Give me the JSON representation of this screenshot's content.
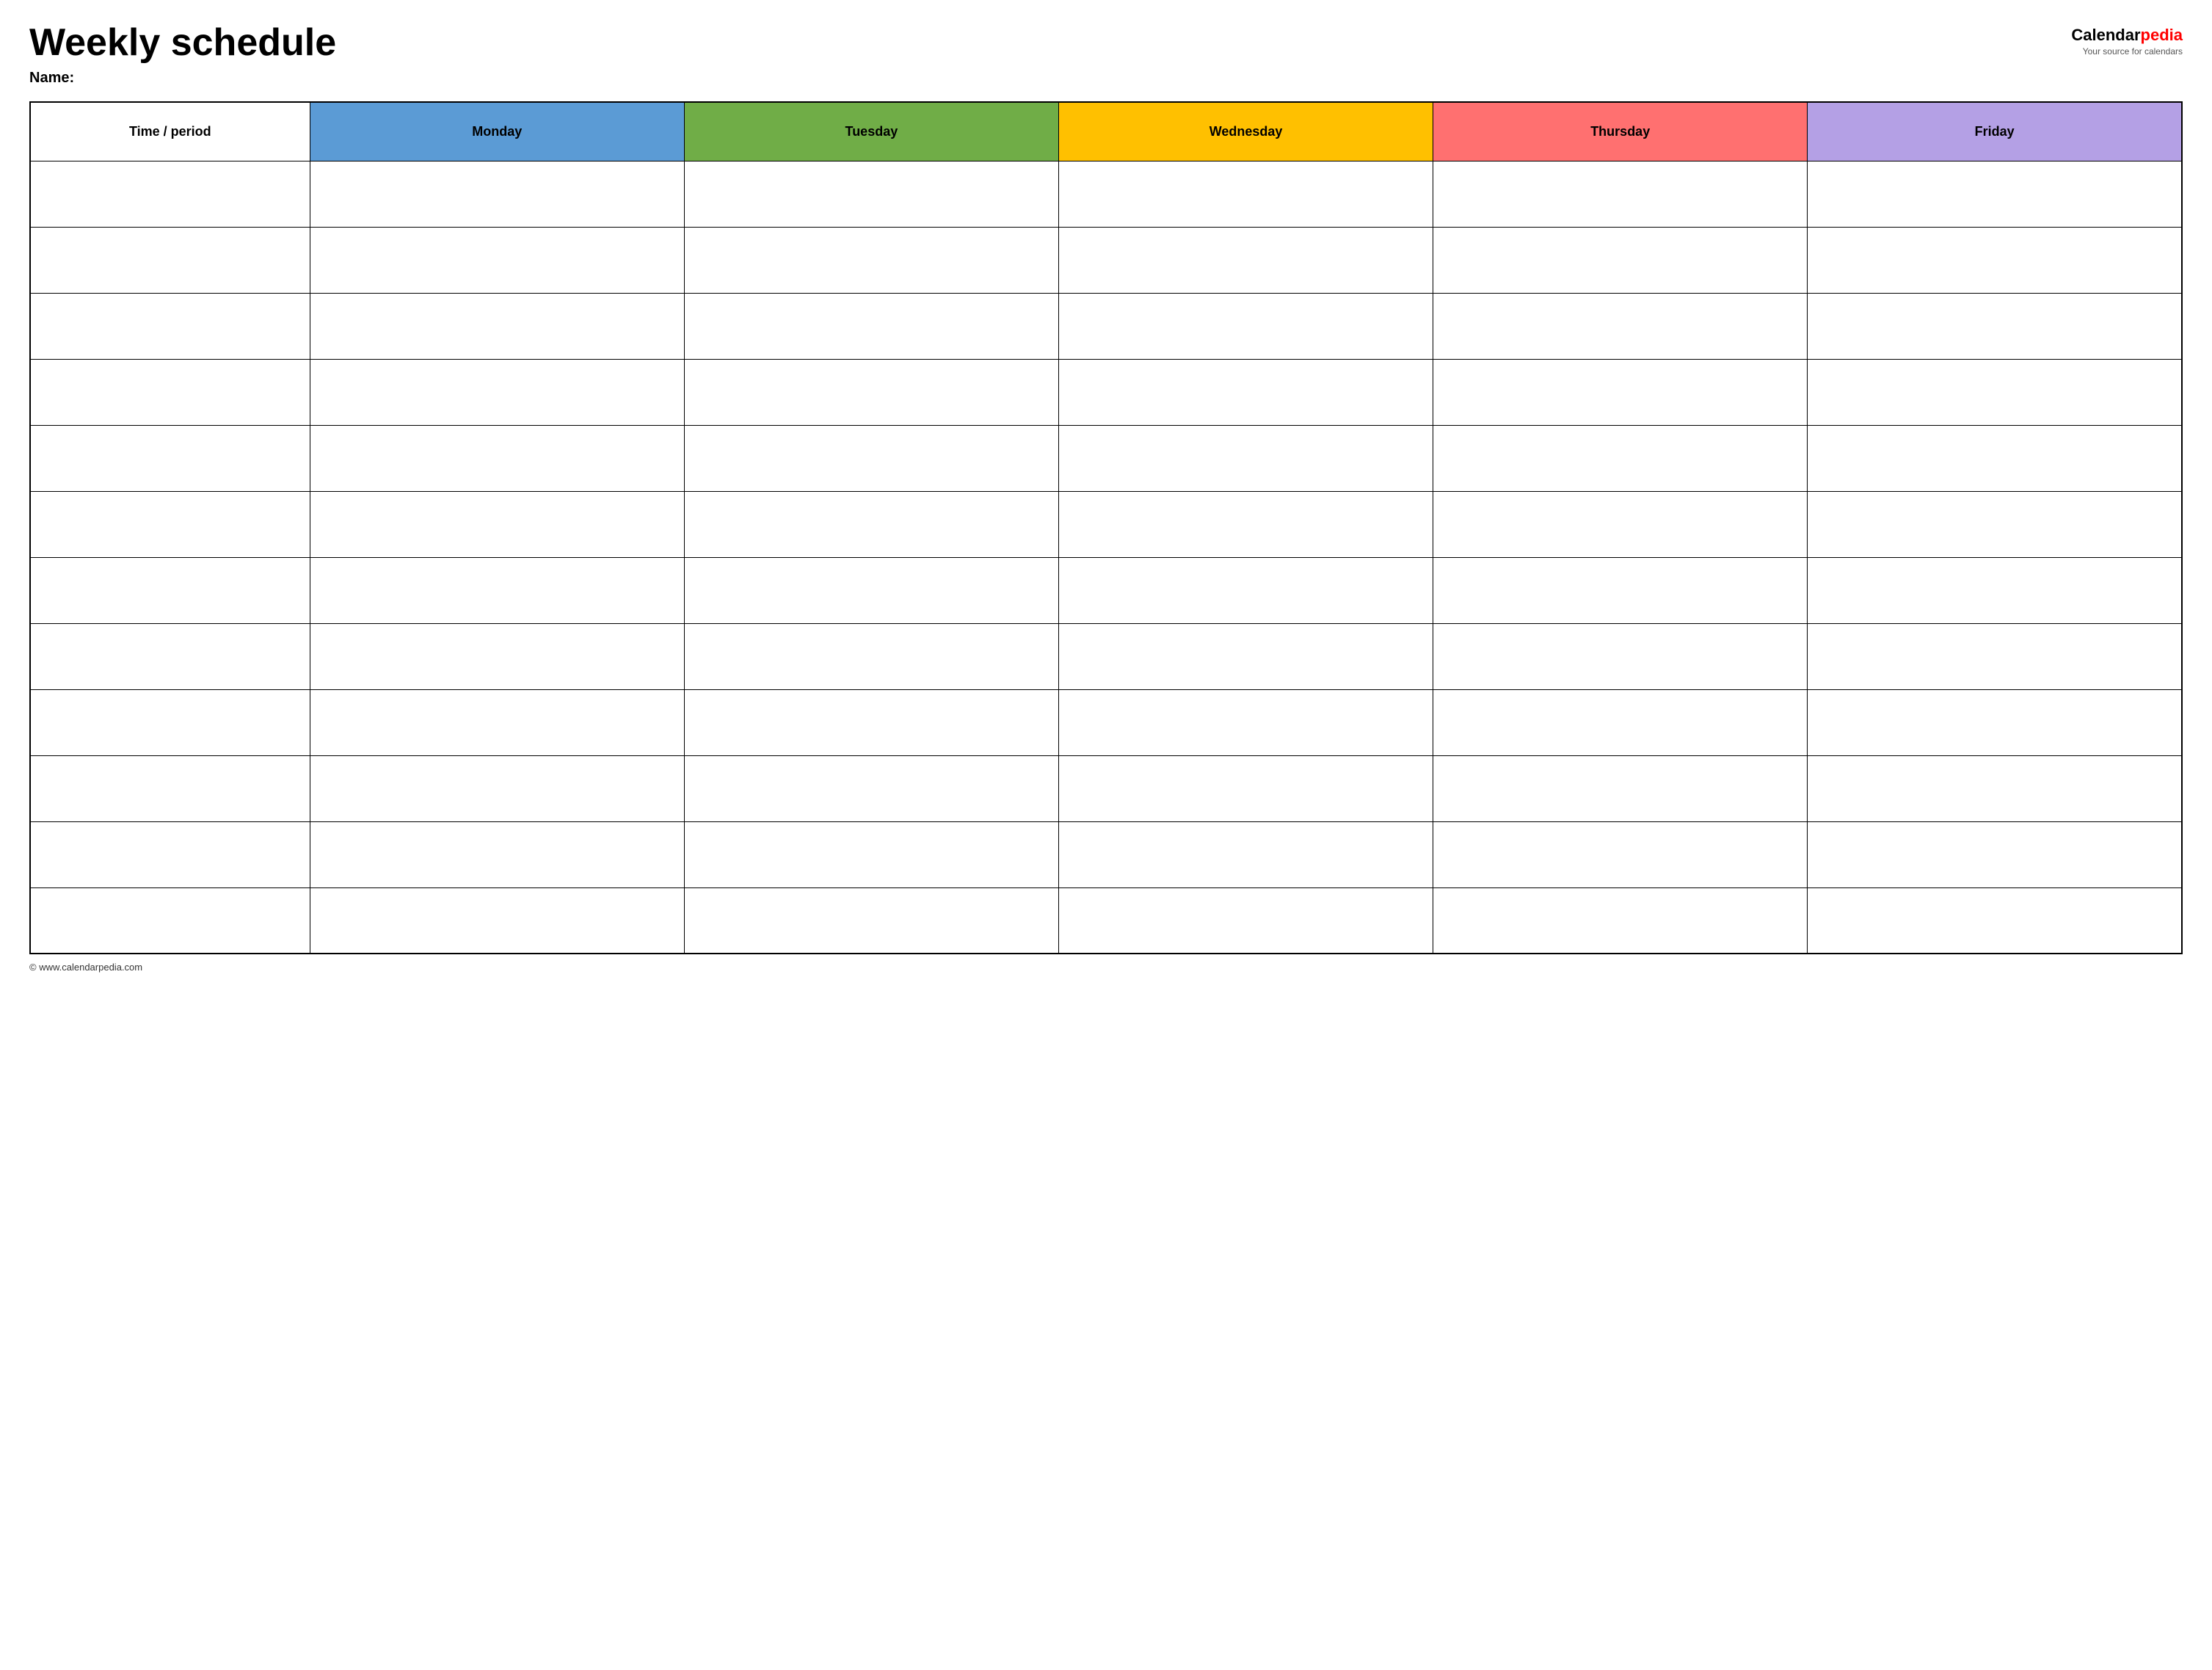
{
  "header": {
    "title": "Weekly schedule",
    "name_label": "Name:",
    "logo": {
      "calendar": "Calendar",
      "pedia": "pedia",
      "tagline": "Your source for calendars"
    }
  },
  "table": {
    "columns": [
      {
        "id": "time",
        "label": "Time / period",
        "color": "#ffffff"
      },
      {
        "id": "monday",
        "label": "Monday",
        "color": "#5b9bd5"
      },
      {
        "id": "tuesday",
        "label": "Tuesday",
        "color": "#70ad47"
      },
      {
        "id": "wednesday",
        "label": "Wednesday",
        "color": "#ffc000"
      },
      {
        "id": "thursday",
        "label": "Thursday",
        "color": "#ff7070"
      },
      {
        "id": "friday",
        "label": "Friday",
        "color": "#b4a0e5"
      }
    ],
    "rows": 12
  },
  "footer": {
    "url": "© www.calendarpedia.com"
  }
}
